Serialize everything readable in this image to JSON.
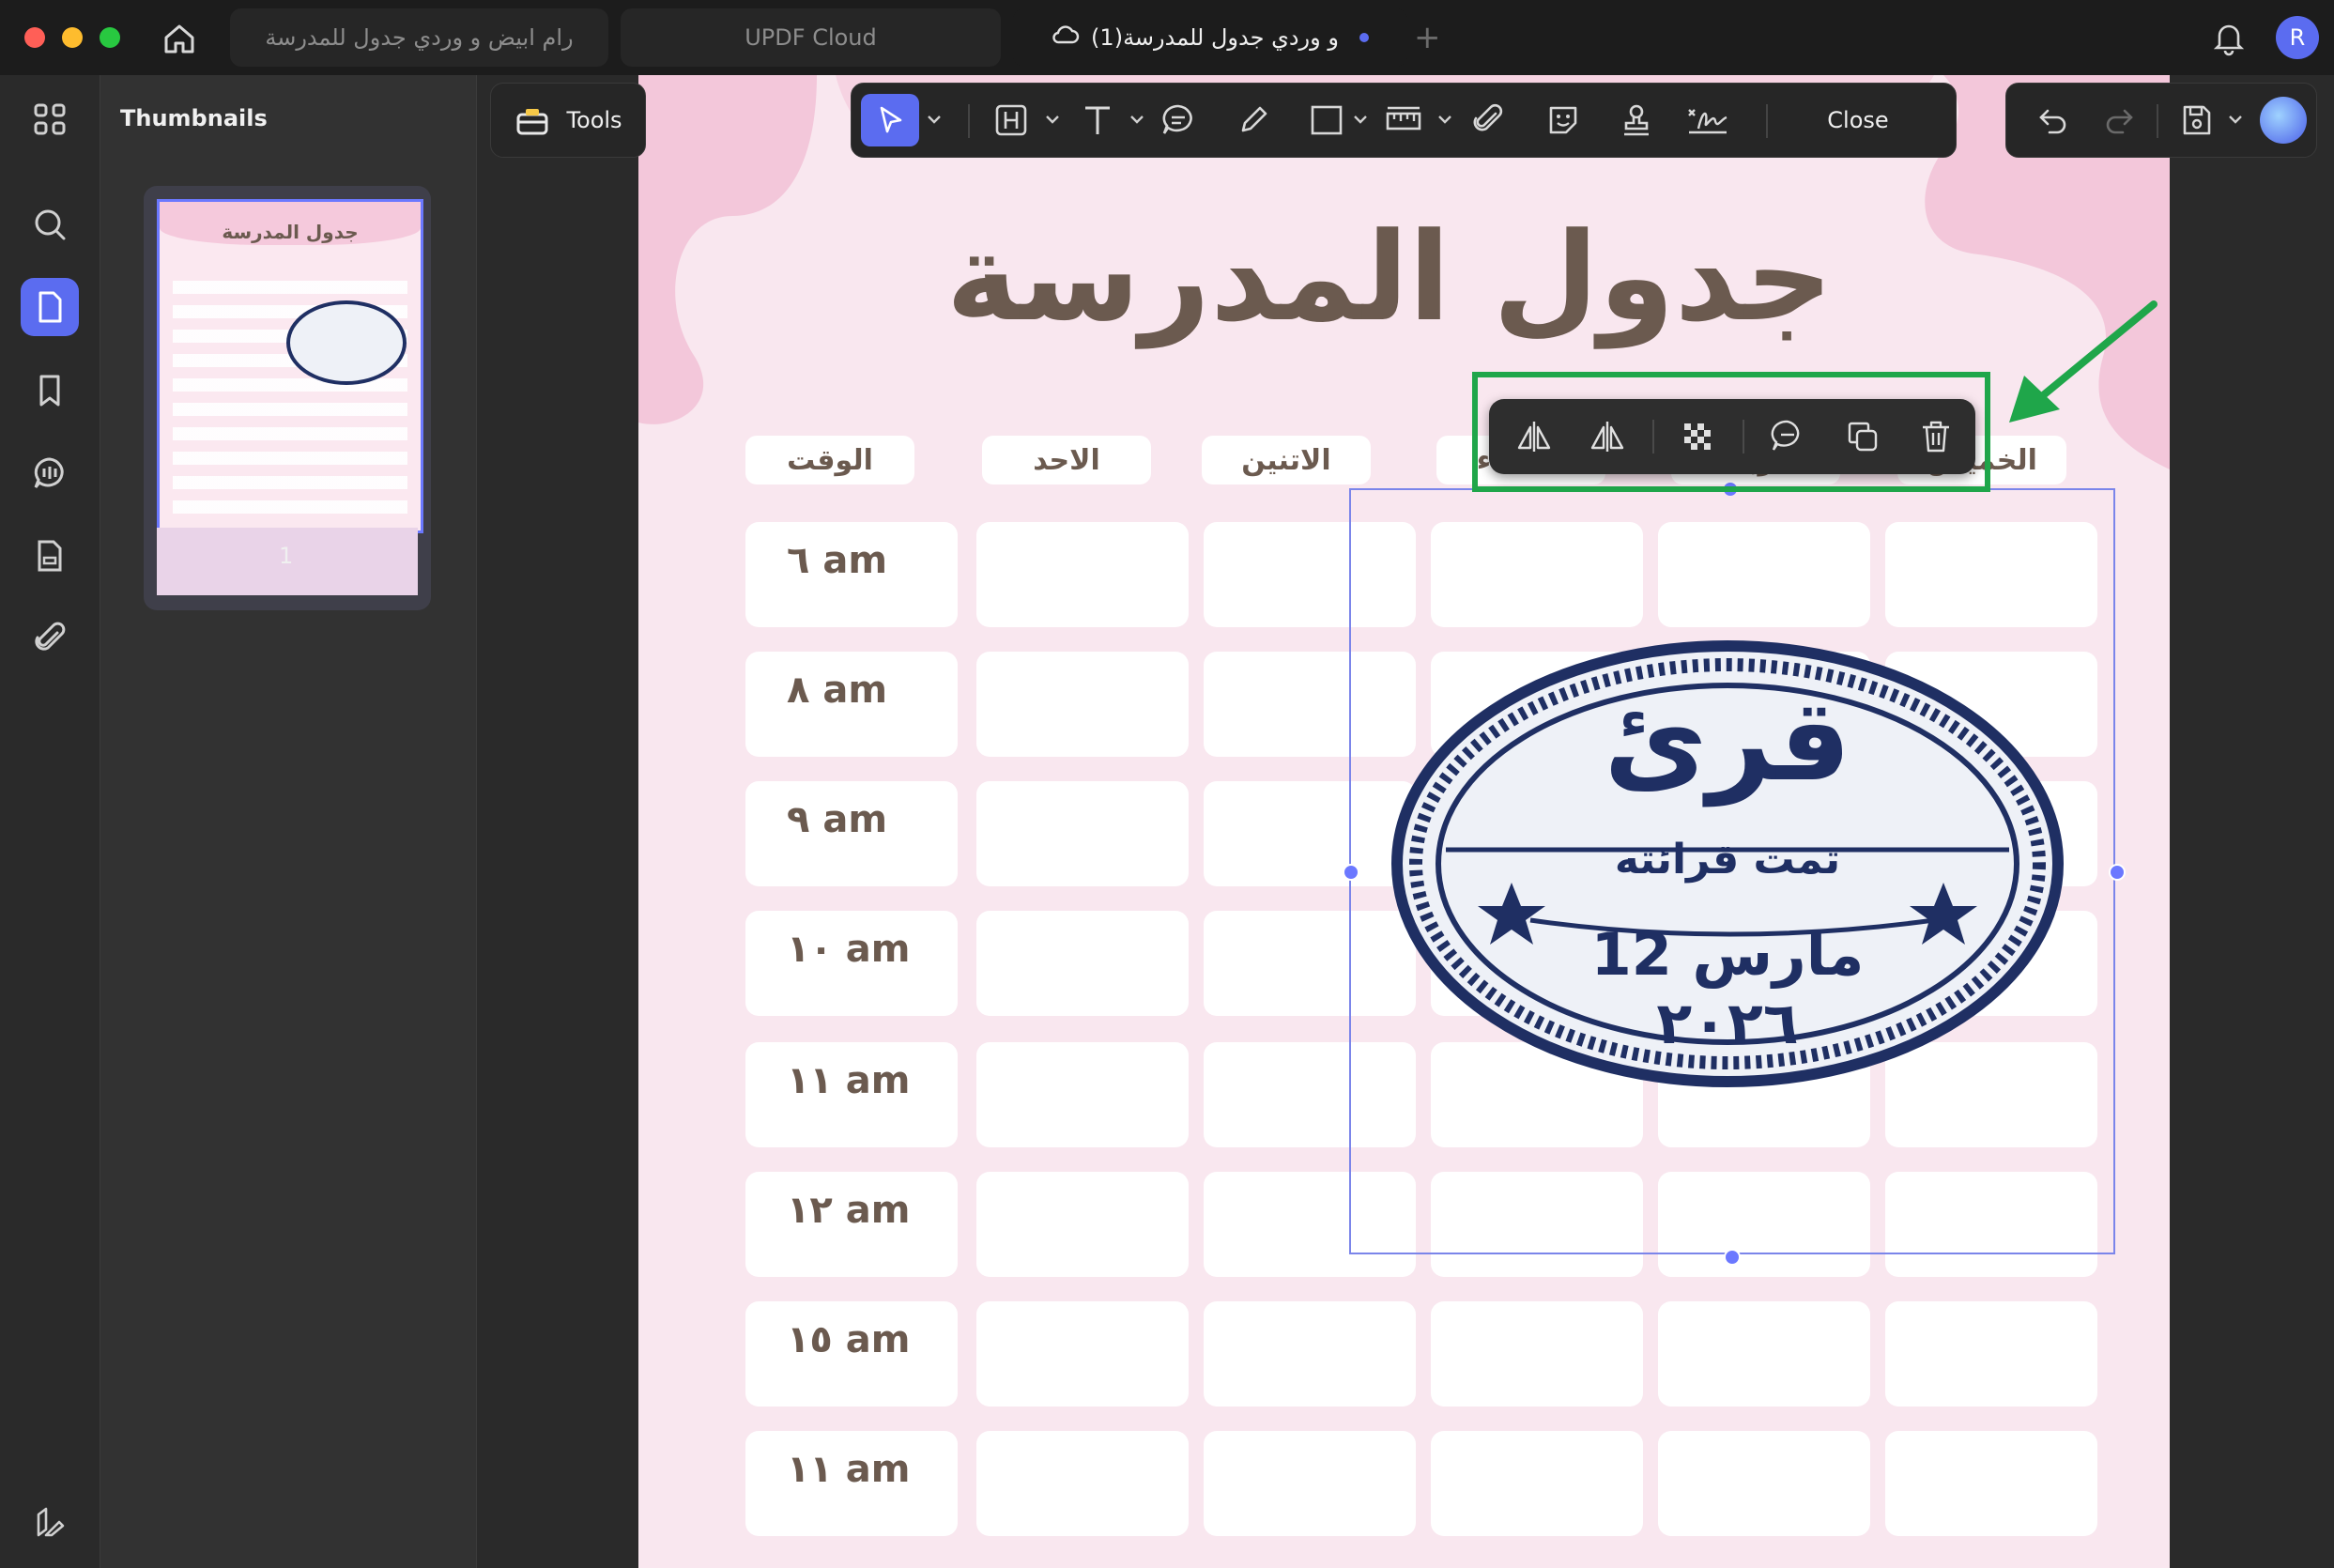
{
  "window": {
    "tabs": [
      {
        "label": "رام ابيض و وردي جدول للمدرسة"
      },
      {
        "label": "UPDF Cloud"
      },
      {
        "label": "و وردي جدول للمدرسة(1)"
      }
    ],
    "avatar_letter": "R"
  },
  "sidebar": {
    "title": "Thumbnails",
    "thumbnail_page": "1"
  },
  "tools_button": {
    "label": "Tools"
  },
  "toolbar": {
    "close_label": "Close"
  },
  "document": {
    "title": "جدول المدرسة",
    "headers": [
      "الوقت",
      "الاحد",
      "الاتنين",
      "الثلاثاء",
      "الاربعاء",
      "الخميس"
    ],
    "times": [
      "٦ am",
      "٨ am",
      "٩ am",
      "١٠ am",
      "١١ am",
      "١٢ am",
      "١٥ am",
      "١١ am"
    ]
  },
  "stamp": {
    "main": "قرئ",
    "sub": "تمت قرائته",
    "date": "12 مارس ٢٠٢٦"
  },
  "colors": {
    "accent": "#5b6cf0",
    "highlight": "#1fa64a",
    "page": "#f9e7ef",
    "blob": "#f3c7da",
    "stamp": "#1f2f63",
    "text": "#6b5a4f"
  }
}
